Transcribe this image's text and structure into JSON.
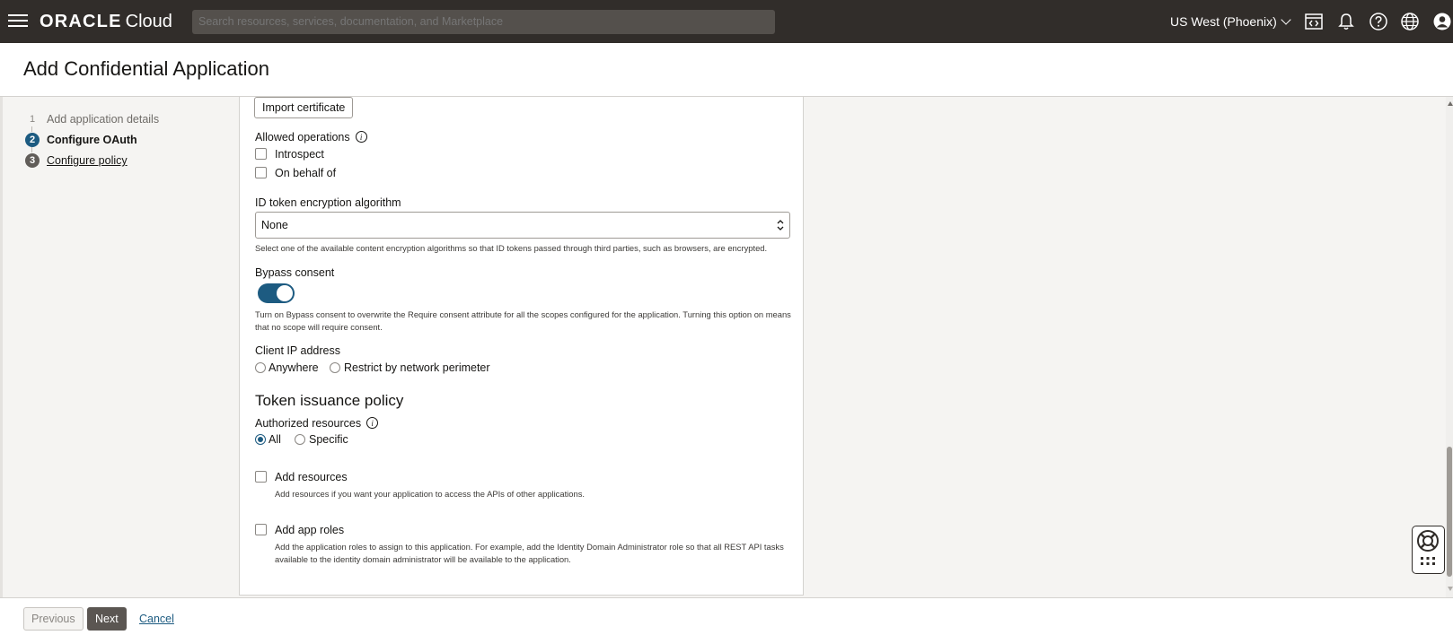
{
  "topbar": {
    "logo_brand": "ORACLE",
    "logo_product": "Cloud",
    "search_placeholder": "Search resources, services, documentation, and Marketplace",
    "region": "US West (Phoenix)"
  },
  "header": {
    "title": "Add Confidential Application"
  },
  "steps": [
    {
      "num": "1",
      "label": "Add application details",
      "state": "done"
    },
    {
      "num": "2",
      "label": "Configure OAuth",
      "state": "active"
    },
    {
      "num": "3",
      "label": "Configure policy",
      "state": "pending"
    }
  ],
  "form": {
    "import_certificate": "Import certificate",
    "allowed_operations": {
      "label": "Allowed operations",
      "introspect": "Introspect",
      "on_behalf_of": "On behalf of"
    },
    "id_token_encryption": {
      "label": "ID token encryption algorithm",
      "value": "None",
      "help": "Select one of the available content encryption algorithms so that ID tokens passed through third parties, such as browsers, are encrypted."
    },
    "bypass_consent": {
      "label": "Bypass consent",
      "enabled": true,
      "help_line1": "Turn on Bypass consent to overwrite the Require consent attribute for all the scopes configured for the application. Turning this option on means",
      "help_line2": "that no scope will require consent."
    },
    "client_ip": {
      "label": "Client IP address",
      "anywhere": "Anywhere",
      "restrict": "Restrict by network perimeter",
      "selected": "none"
    },
    "token_issuance": {
      "title": "Token issuance policy",
      "authorized_resources_label": "Authorized resources",
      "all": "All",
      "specific": "Specific",
      "selected": "All"
    },
    "add_resources": {
      "label": "Add resources",
      "help": "Add resources if you want your application to access the APIs of other applications."
    },
    "add_app_roles": {
      "label": "Add app roles",
      "help_line1": "Add the application roles to assign to this application. For example, add the Identity Domain Administrator role so that all REST API tasks",
      "help_line2": "available to the identity domain administrator will be available to the application."
    }
  },
  "footer": {
    "previous": "Previous",
    "next": "Next",
    "cancel": "Cancel"
  },
  "colors": {
    "topbar": "#312d2a",
    "accent": "#1d5b81",
    "primary_button": "#5b5652"
  }
}
